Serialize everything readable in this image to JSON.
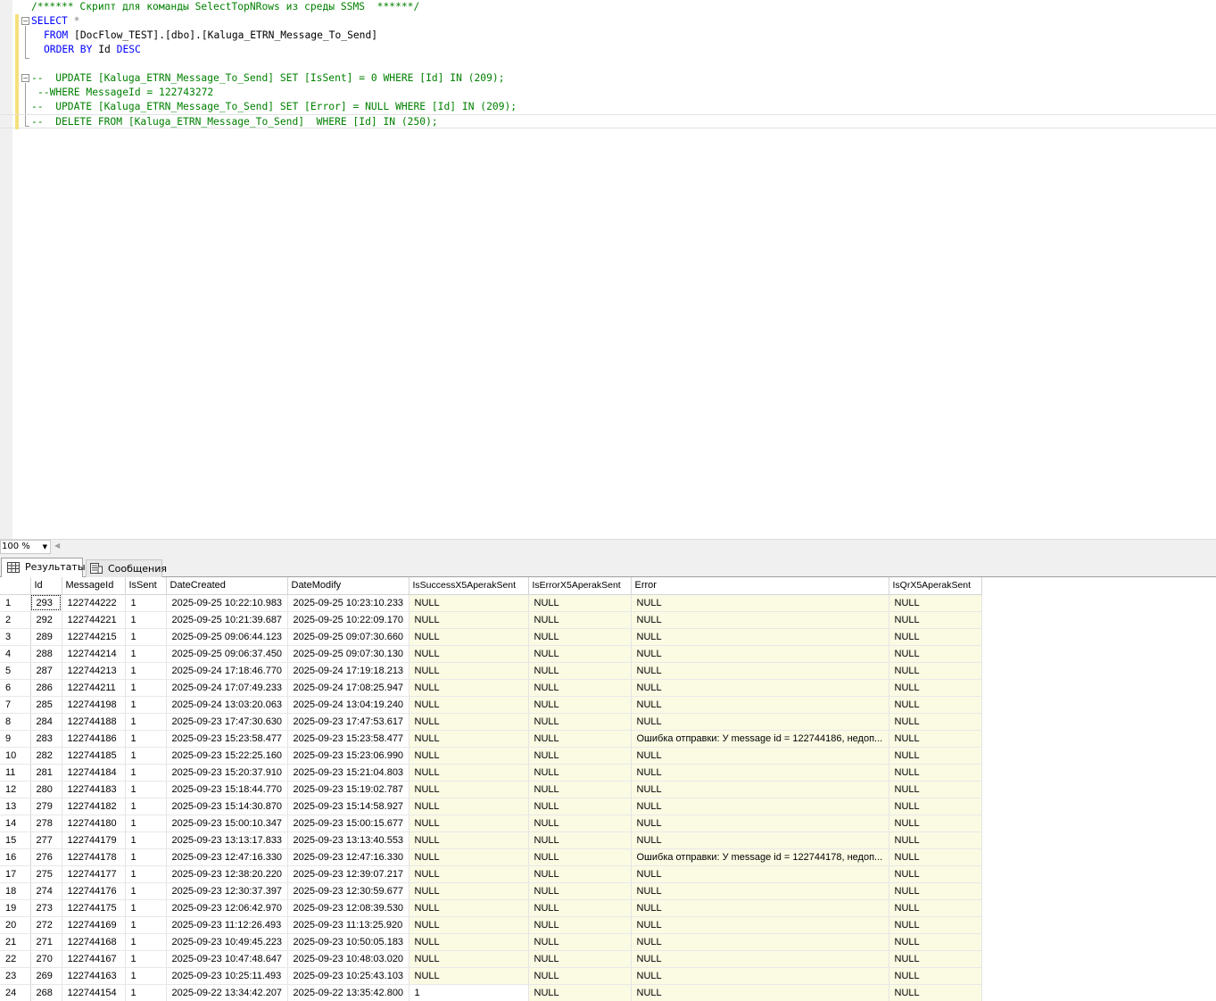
{
  "editor": {
    "line1_comment": "/****** Скрипт для команды SelectTopNRows из среды SSMS  ******/",
    "line2_select": "SELECT",
    "line2_star": " *",
    "line3_from_kw": "FROM",
    "line3_from_obj": " [DocFlow_TEST].[dbo].[Kaluga_ETRN_Message_To_Send]",
    "line4_order_kw": "ORDER BY",
    "line4_id": " Id ",
    "line4_desc": "DESC",
    "line6": "--  UPDATE [Kaluga_ETRN_Message_To_Send] SET [IsSent] = 0 WHERE [Id] IN (209);",
    "line7": "--WHERE MessageId = 122743272",
    "line8": "--  UPDATE [Kaluga_ETRN_Message_To_Send] SET [Error] = NULL WHERE [Id] IN (209);",
    "line9": "--  DELETE FROM [Kaluga_ETRN_Message_To_Send]  WHERE [Id] IN (250);"
  },
  "zoom": {
    "value": "100 %"
  },
  "tabs": {
    "results": "Результаты",
    "messages": "Сообщения"
  },
  "grid": {
    "columns": [
      "Id",
      "MessageId",
      "IsSent",
      "DateCreated",
      "DateModify",
      "IsSuccessX5AperakSent",
      "IsErrorX5AperakSent",
      "Error",
      "IsQrX5AperakSent"
    ],
    "rows": [
      [
        "1",
        "293",
        "122744222",
        "1",
        "2025-09-25 10:22:10.983",
        "2025-09-25 10:23:10.233",
        "NULL",
        "NULL",
        "NULL",
        "NULL"
      ],
      [
        "2",
        "292",
        "122744221",
        "1",
        "2025-09-25 10:21:39.687",
        "2025-09-25 10:22:09.170",
        "NULL",
        "NULL",
        "NULL",
        "NULL"
      ],
      [
        "3",
        "289",
        "122744215",
        "1",
        "2025-09-25 09:06:44.123",
        "2025-09-25 09:07:30.660",
        "NULL",
        "NULL",
        "NULL",
        "NULL"
      ],
      [
        "4",
        "288",
        "122744214",
        "1",
        "2025-09-25 09:06:37.450",
        "2025-09-25 09:07:30.130",
        "NULL",
        "NULL",
        "NULL",
        "NULL"
      ],
      [
        "5",
        "287",
        "122744213",
        "1",
        "2025-09-24 17:18:46.770",
        "2025-09-24 17:19:18.213",
        "NULL",
        "NULL",
        "NULL",
        "NULL"
      ],
      [
        "6",
        "286",
        "122744211",
        "1",
        "2025-09-24 17:07:49.233",
        "2025-09-24 17:08:25.947",
        "NULL",
        "NULL",
        "NULL",
        "NULL"
      ],
      [
        "7",
        "285",
        "122744198",
        "1",
        "2025-09-24 13:03:20.063",
        "2025-09-24 13:04:19.240",
        "NULL",
        "NULL",
        "NULL",
        "NULL"
      ],
      [
        "8",
        "284",
        "122744188",
        "1",
        "2025-09-23 17:47:30.630",
        "2025-09-23 17:47:53.617",
        "NULL",
        "NULL",
        "NULL",
        "NULL"
      ],
      [
        "9",
        "283",
        "122744186",
        "1",
        "2025-09-23 15:23:58.477",
        "2025-09-23 15:23:58.477",
        "NULL",
        "NULL",
        "Ошибка отправки: У message id = 122744186, недоп...",
        "NULL"
      ],
      [
        "10",
        "282",
        "122744185",
        "1",
        "2025-09-23 15:22:25.160",
        "2025-09-23 15:23:06.990",
        "NULL",
        "NULL",
        "NULL",
        "NULL"
      ],
      [
        "11",
        "281",
        "122744184",
        "1",
        "2025-09-23 15:20:37.910",
        "2025-09-23 15:21:04.803",
        "NULL",
        "NULL",
        "NULL",
        "NULL"
      ],
      [
        "12",
        "280",
        "122744183",
        "1",
        "2025-09-23 15:18:44.770",
        "2025-09-23 15:19:02.787",
        "NULL",
        "NULL",
        "NULL",
        "NULL"
      ],
      [
        "13",
        "279",
        "122744182",
        "1",
        "2025-09-23 15:14:30.870",
        "2025-09-23 15:14:58.927",
        "NULL",
        "NULL",
        "NULL",
        "NULL"
      ],
      [
        "14",
        "278",
        "122744180",
        "1",
        "2025-09-23 15:00:10.347",
        "2025-09-23 15:00:15.677",
        "NULL",
        "NULL",
        "NULL",
        "NULL"
      ],
      [
        "15",
        "277",
        "122744179",
        "1",
        "2025-09-23 13:13:17.833",
        "2025-09-23 13:13:40.553",
        "NULL",
        "NULL",
        "NULL",
        "NULL"
      ],
      [
        "16",
        "276",
        "122744178",
        "1",
        "2025-09-23 12:47:16.330",
        "2025-09-23 12:47:16.330",
        "NULL",
        "NULL",
        "Ошибка отправки: У message id = 122744178, недоп...",
        "NULL"
      ],
      [
        "17",
        "275",
        "122744177",
        "1",
        "2025-09-23 12:38:20.220",
        "2025-09-23 12:39:07.217",
        "NULL",
        "NULL",
        "NULL",
        "NULL"
      ],
      [
        "18",
        "274",
        "122744176",
        "1",
        "2025-09-23 12:30:37.397",
        "2025-09-23 12:30:59.677",
        "NULL",
        "NULL",
        "NULL",
        "NULL"
      ],
      [
        "19",
        "273",
        "122744175",
        "1",
        "2025-09-23 12:06:42.970",
        "2025-09-23 12:08:39.530",
        "NULL",
        "NULL",
        "NULL",
        "NULL"
      ],
      [
        "20",
        "272",
        "122744169",
        "1",
        "2025-09-23 11:12:26.493",
        "2025-09-23 11:13:25.920",
        "NULL",
        "NULL",
        "NULL",
        "NULL"
      ],
      [
        "21",
        "271",
        "122744168",
        "1",
        "2025-09-23 10:49:45.223",
        "2025-09-23 10:50:05.183",
        "NULL",
        "NULL",
        "NULL",
        "NULL"
      ],
      [
        "22",
        "270",
        "122744167",
        "1",
        "2025-09-23 10:47:48.647",
        "2025-09-23 10:48:03.020",
        "NULL",
        "NULL",
        "NULL",
        "NULL"
      ],
      [
        "23",
        "269",
        "122744163",
        "1",
        "2025-09-23 10:25:11.493",
        "2025-09-23 10:25:43.103",
        "NULL",
        "NULL",
        "NULL",
        "NULL"
      ],
      [
        "24",
        "268",
        "122744154",
        "1",
        "2025-09-22 13:34:42.207",
        "2025-09-22 13:35:42.800",
        "1",
        "NULL",
        "NULL",
        "NULL"
      ]
    ]
  }
}
